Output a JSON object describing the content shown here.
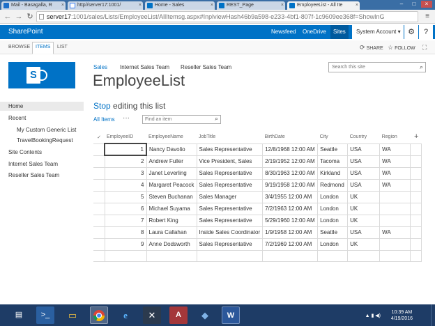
{
  "browser": {
    "tabs": [
      {
        "label": "Mail - Basagalla, R",
        "icon": "mail-icon",
        "color": "#1e6fc9"
      },
      {
        "label": "http//server17:1001/",
        "icon": "google-icon",
        "color": "#ffffff"
      },
      {
        "label": "Home - Sales",
        "icon": "sharepoint-icon",
        "color": "#0072c6"
      },
      {
        "label": "REST_Page",
        "icon": "sharepoint-icon",
        "color": "#0072c6"
      },
      {
        "label": "EmployeeList - All Ite",
        "icon": "sharepoint-icon",
        "color": "#0072c6"
      }
    ],
    "url_host": "server17",
    "url_rest": ":1001/sales/Lists/EmployeeList/AllItemsg.aspx#InplviewHash46b9a598-e233-4bf1-807f-1c9609ee368f=ShowInG"
  },
  "suitebar": {
    "brand": "SharePoint",
    "nav": [
      "Newsfeed",
      "OneDrive",
      "Sites"
    ],
    "account": "System Account ▾",
    "settings_glyph": "⚙",
    "help_glyph": "?"
  },
  "ribbon": {
    "tabs": [
      "BROWSE",
      "ITEMS",
      "LIST"
    ],
    "share": "SHARE",
    "follow": "FOLLOW"
  },
  "site": {
    "topnav": [
      "Sales",
      "Internet Sales Team",
      "Reseller Sales Team"
    ],
    "title": "EmployeeList",
    "search_placeholder": "Search this site"
  },
  "leftnav": {
    "home": "Home",
    "recent": "Recent",
    "recent_items": [
      "My Custom Generic List",
      "TravelBookingRequest"
    ],
    "site_contents": "Site Contents",
    "internet": "Internet Sales Team",
    "reseller": "Reseller Sales Team"
  },
  "list": {
    "stop": "Stop",
    "editing": " editing this list",
    "view": "All Items",
    "more": "···",
    "find_placeholder": "Find an item",
    "add_column": "+",
    "columns": [
      "EmployeeID",
      "EmployeeName",
      "JobTitle",
      "BirthDate",
      "City",
      "Country",
      "Region"
    ],
    "rows": [
      [
        "1",
        "Nancy Davolio",
        "Sales Representative",
        "12/8/1968 12:00 AM",
        "Seattle",
        "USA",
        "WA"
      ],
      [
        "2",
        "Andrew Fuller",
        "Vice President, Sales",
        "2/19/1952 12:00 AM",
        "Tacoma",
        "USA",
        "WA"
      ],
      [
        "3",
        "Janet Leverling",
        "Sales Representative",
        "8/30/1963 12:00 AM",
        "Kirkland",
        "USA",
        "WA"
      ],
      [
        "4",
        "Margaret Peacock",
        "Sales Representative",
        "9/19/1958 12:00 AM",
        "Redmond",
        "USA",
        "WA"
      ],
      [
        "5",
        "Steven Buchanan",
        "Sales Manager",
        "3/4/1955 12:00 AM",
        "London",
        "UK",
        ""
      ],
      [
        "6",
        "Michael Suyama",
        "Sales Representative",
        "7/2/1963 12:00 AM",
        "London",
        "UK",
        ""
      ],
      [
        "7",
        "Robert King",
        "Sales Representative",
        "5/29/1960 12:00 AM",
        "London",
        "UK",
        ""
      ],
      [
        "8",
        "Laura Callahan",
        "Inside Sales Coordinator",
        "1/9/1958 12:00 AM",
        "Seattle",
        "USA",
        "WA"
      ],
      [
        "9",
        "Anne Dodsworth",
        "Sales Representative",
        "7/2/1969 12:00 AM",
        "London",
        "UK",
        ""
      ]
    ]
  },
  "taskbar": {
    "time": "10:39 AM",
    "date": "4/19/2016"
  }
}
